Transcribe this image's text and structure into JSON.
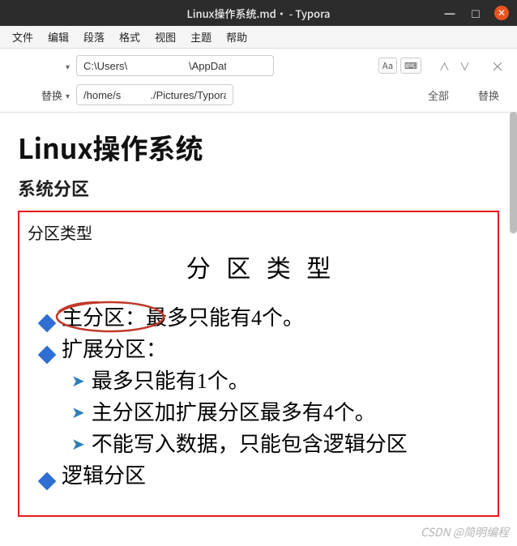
{
  "titlebar": {
    "title": "Linux操作系统.md• - Typora"
  },
  "menubar": {
    "items": [
      "文件",
      "编辑",
      "段落",
      "格式",
      "视图",
      "主题",
      "帮助"
    ]
  },
  "search": {
    "find_value": "C:\\Users\\                     \\AppData\\Roaming\\Typora",
    "replace_label": "替换",
    "replace_value": "/home/s          ./Pictures/Typora_imgs/",
    "case_label": "Aa",
    "regex_label": "⌨",
    "all_label": "全部",
    "do_replace_label": "替换"
  },
  "doc": {
    "h1": "Linux操作系统",
    "h2": "系统分区",
    "slide_caption": "分区类型",
    "slide_title": "分 区 类 型",
    "b1_emph": "主分区：",
    "b1_rest": "最多只能有4个。",
    "b2": "扩展分区：",
    "s1": "最多只能有1个。",
    "s2": "主分区加扩展分区最多有4个。",
    "s3": "不能写入数据，只能包含逻辑分区",
    "b3": "逻辑分区"
  },
  "watermark": "CSDN @简明编程"
}
